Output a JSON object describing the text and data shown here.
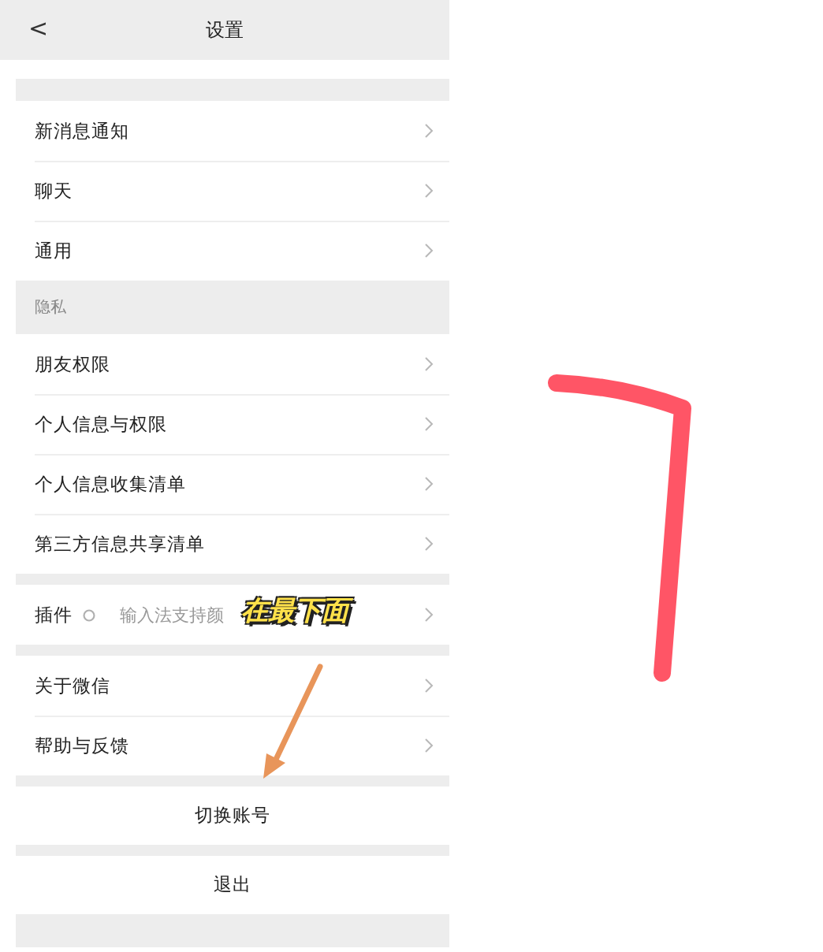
{
  "header": {
    "back": "<",
    "title": "设置"
  },
  "groups": [
    {
      "items": [
        {
          "label": "新消息通知"
        },
        {
          "label": "聊天"
        },
        {
          "label": "通用"
        }
      ]
    },
    {
      "section": "隐私",
      "items": [
        {
          "label": "朋友权限"
        },
        {
          "label": "个人信息与权限"
        },
        {
          "label": "个人信息收集清单"
        },
        {
          "label": "第三方信息共享清单"
        }
      ]
    },
    {
      "items": [
        {
          "label": "插件",
          "badge": true,
          "value": "输入法支持颜"
        }
      ]
    },
    {
      "items": [
        {
          "label": "关于微信"
        },
        {
          "label": "帮助与反馈"
        }
      ]
    }
  ],
  "actions": [
    "切换账号",
    "退出"
  ],
  "annotation": {
    "caption": "在最下面"
  }
}
